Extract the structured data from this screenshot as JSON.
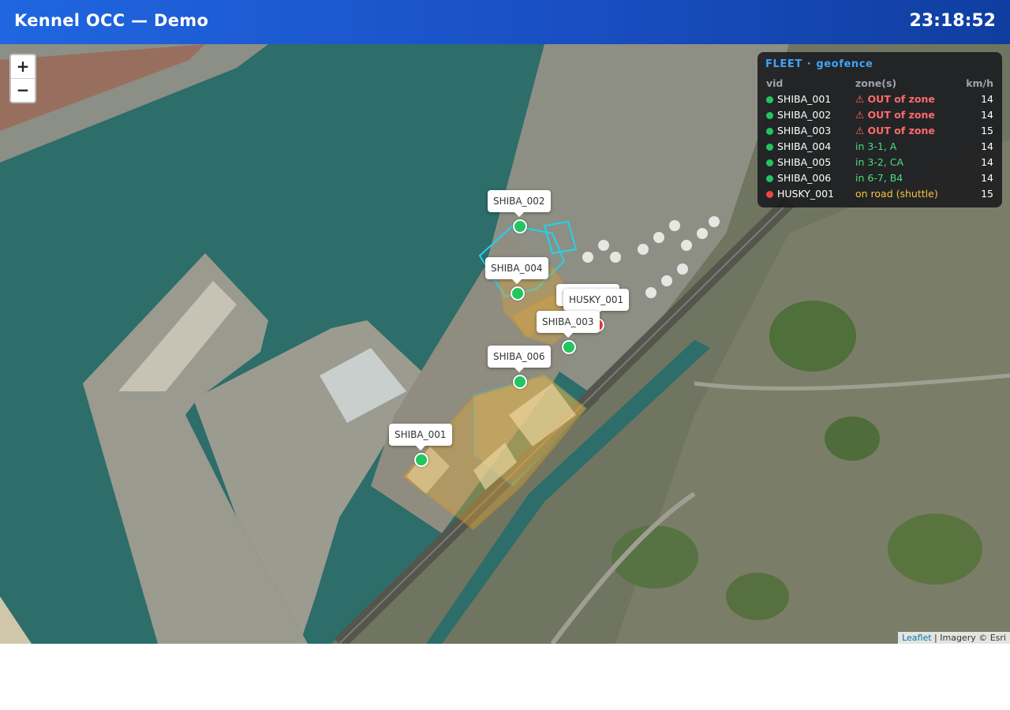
{
  "header": {
    "title": "Kennel OCC — Demo",
    "clock": "23:18:52"
  },
  "zoom": {
    "in": "+",
    "out": "−"
  },
  "panel": {
    "title_a": "FLEET",
    "title_sep": "·",
    "title_b": "geofence",
    "columns": {
      "vid": "vid",
      "zone": "zone(s)",
      "kmh": "km/h"
    },
    "rows": [
      {
        "vid": "SHIBA_001",
        "zone": "⚠ OUT of zone",
        "kmh": "14",
        "status_color": "#22c55e",
        "zone_color": "#ff6b6b"
      },
      {
        "vid": "SHIBA_002",
        "zone": "⚠ OUT of zone",
        "kmh": "14",
        "status_color": "#22c55e",
        "zone_color": "#ff6b6b"
      },
      {
        "vid": "SHIBA_003",
        "zone": "⚠ OUT of zone",
        "kmh": "15",
        "status_color": "#22c55e",
        "zone_color": "#ff6b6b"
      },
      {
        "vid": "SHIBA_004",
        "zone": "in 3-1, A",
        "kmh": "14",
        "status_color": "#22c55e",
        "zone_color": "#4ade80"
      },
      {
        "vid": "SHIBA_005",
        "zone": "in 3-2, CA",
        "kmh": "14",
        "status_color": "#22c55e",
        "zone_color": "#4ade80"
      },
      {
        "vid": "SHIBA_006",
        "zone": "in 6-7, B4",
        "kmh": "14",
        "status_color": "#22c55e",
        "zone_color": "#4ade80"
      },
      {
        "vid": "HUSKY_001",
        "zone": "on road (shuttle)",
        "kmh": "15",
        "status_color": "#ef4444",
        "zone_color": "#f5c542"
      }
    ]
  },
  "markers": {
    "shiba_002": "SHIBA_002",
    "shiba_004": "SHIBA_004",
    "shiba_005": "SHIBA_005",
    "husky_001": "HUSKY_001",
    "shiba_003": "SHIBA_003",
    "shiba_006": "SHIBA_006",
    "shiba_001": "SHIBA_001"
  },
  "attribution": {
    "link": "Leaflet",
    "sep": " | ",
    "text": "Imagery © Esri"
  }
}
